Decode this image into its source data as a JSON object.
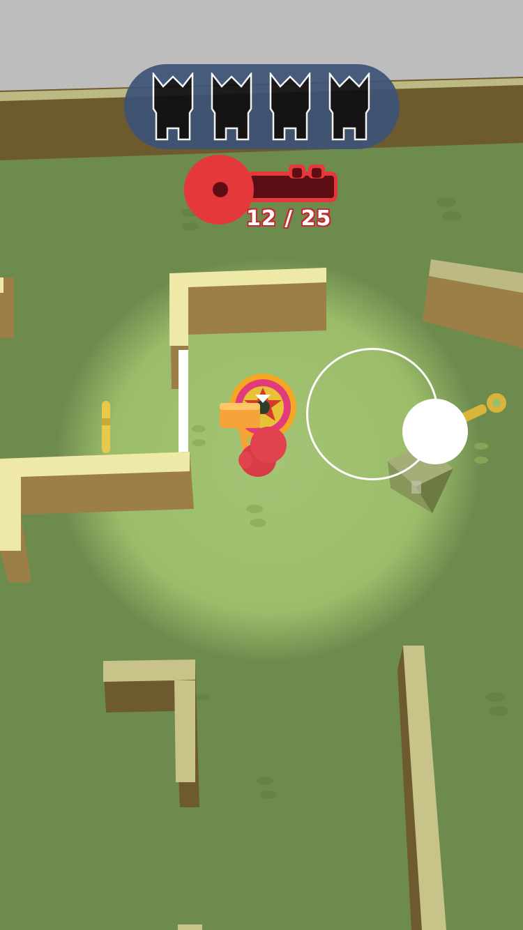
{
  "hud": {
    "enemies_remaining_icons": [
      "enemy-silhouette",
      "enemy-silhouette",
      "enemy-silhouette",
      "enemy-silhouette"
    ],
    "key_progress": {
      "current": 12,
      "total": 25,
      "text": "12 / 25",
      "icon": "key-icon",
      "fill_fraction": 0.48
    }
  },
  "colors": {
    "grass": "#9dbf6c",
    "grass_dark": "#6e8b4e",
    "wall_top": "#efe9a8",
    "wall_side": "#9c7f47",
    "key_red": "#e5383b",
    "key_dark": "#5d0d14",
    "hud_bg": "#3d5478",
    "player": "#e2424d",
    "hammer": "#f6a33a"
  },
  "joystick": {
    "icon": "joystick"
  }
}
